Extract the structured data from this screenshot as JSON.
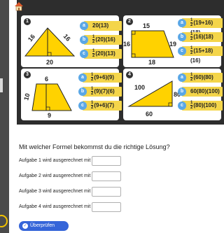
{
  "cards": [
    {
      "number": "1",
      "labels": [
        "16",
        "16",
        "20"
      ],
      "options": [
        {
          "letter": "a",
          "frac": false,
          "text": "20(13)"
        },
        {
          "letter": "b",
          "frac": true,
          "num": "1",
          "den": "2",
          "text": "(20)(16)"
        },
        {
          "letter": "c",
          "frac": true,
          "num": "1",
          "den": "2",
          "text": "(20)(13)"
        }
      ]
    },
    {
      "number": "2",
      "labels": [
        "15",
        "16",
        "19",
        "18"
      ],
      "options": [
        {
          "letter": "a",
          "frac": true,
          "num": "1",
          "den": "2",
          "text": "(19+16)(18)"
        },
        {
          "letter": "b",
          "frac": true,
          "num": "1",
          "den": "2",
          "text": "(16)(18)"
        },
        {
          "letter": "c",
          "frac": true,
          "num": "1",
          "den": "2",
          "text": "(15+18)(16)"
        }
      ]
    },
    {
      "number": "3",
      "labels": [
        "6",
        "10",
        "9"
      ],
      "options": [
        {
          "letter": "a",
          "frac": true,
          "num": "1",
          "den": "2",
          "text": "(9+6)(9)"
        },
        {
          "letter": "b",
          "frac": true,
          "num": "1",
          "den": "2",
          "text": "(9)(7)(6)"
        },
        {
          "letter": "c",
          "frac": true,
          "num": "1",
          "den": "2",
          "text": "(9+6)(7)"
        }
      ]
    },
    {
      "number": "4",
      "labels": [
        "100",
        "80",
        "60"
      ],
      "options": [
        {
          "letter": "a",
          "frac": true,
          "num": "1",
          "den": "2",
          "text": "(60)(80)"
        },
        {
          "letter": "b",
          "frac": false,
          "text": "60(80)(100)"
        },
        {
          "letter": "c",
          "frac": true,
          "num": "1",
          "den": "2",
          "text": "(80)(100)"
        }
      ]
    }
  ],
  "question": "Mit welcher Formel bekommst du die richtige Lösung?",
  "answers": [
    "Aufgabe 1 wird ausgerechnet mit",
    "Aufgabe 2 wird ausgerechnet mit",
    "Aufgabe 3 wird ausgerechnet mit",
    "Aufgabe 4 wird ausgerechnet mit"
  ],
  "check_button": "Überprüfen",
  "check_icon": "check-icon",
  "colors": {
    "accent": "#3565d9",
    "option": "#f4d54a",
    "option_dot": "#5aa7e6",
    "panel": "#2d2d2d"
  }
}
